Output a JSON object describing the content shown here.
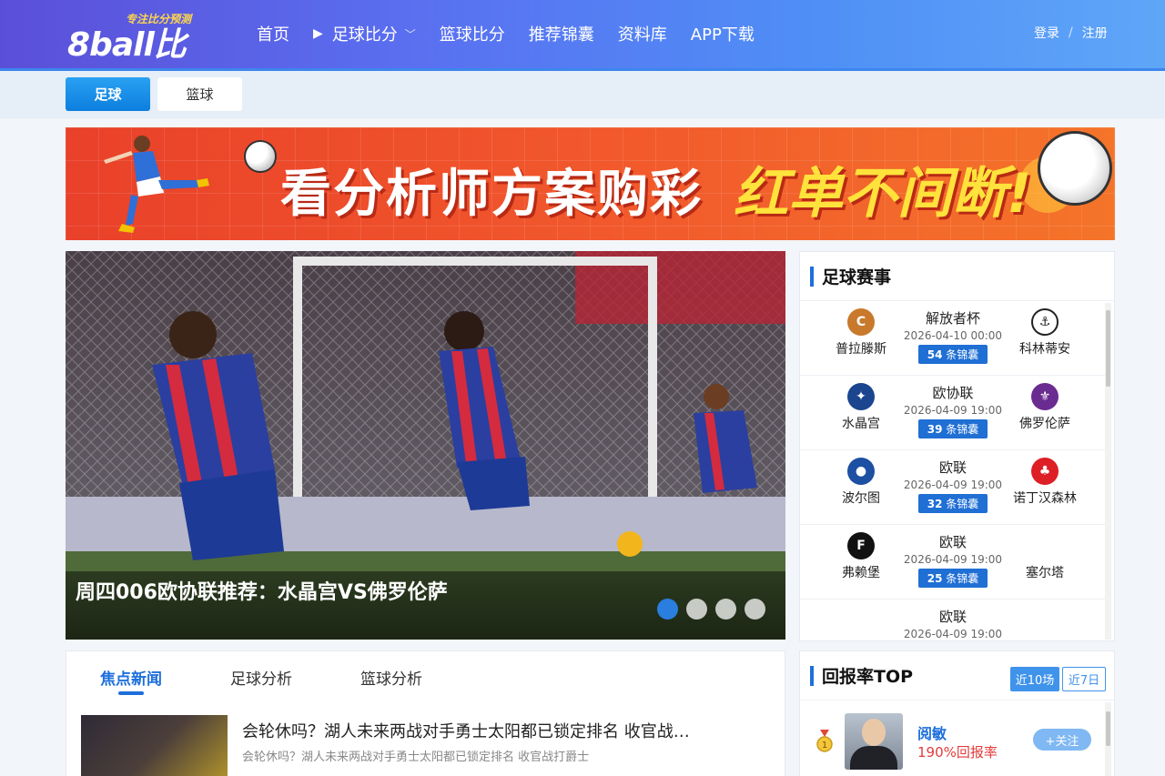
{
  "header": {
    "brand": "8ball比分",
    "slogan": "专注比分预测",
    "nav": [
      {
        "label": "首页"
      },
      {
        "label": "足球比分"
      },
      {
        "label": "篮球比分"
      },
      {
        "label": "推荐锦囊"
      },
      {
        "label": "资料库"
      },
      {
        "label": "APP下载"
      }
    ],
    "login": "登录",
    "separator": "/",
    "register": "注册"
  },
  "sport_tabs": [
    {
      "label": "足球",
      "active": true
    },
    {
      "label": "篮球",
      "active": false
    }
  ],
  "banner": {
    "text_main": "看分析师方案购彩",
    "text_highlight": "红单不间断!"
  },
  "hero": {
    "caption": "周四006欧协联推荐：水晶宫VS佛罗伦萨",
    "slides": 4,
    "active_slide": 1
  },
  "matches": {
    "title": "足球赛事",
    "tips_suffix": "条锦囊",
    "items": [
      {
        "league": "解放者杯",
        "time": "2026-04-10 00:00",
        "tips": "54",
        "home": "普拉滕斯",
        "away": "科林蒂安",
        "home_color": "#c9792b",
        "away_color": "#222222"
      },
      {
        "league": "欧协联",
        "time": "2026-04-09 19:00",
        "tips": "39",
        "home": "水晶宫",
        "away": "佛罗伦萨",
        "home_color": "#1b458f",
        "away_color": "#6a2c91"
      },
      {
        "league": "欧联",
        "time": "2026-04-09 19:00",
        "tips": "32",
        "home": "波尔图",
        "away": "诺丁汉森林",
        "home_color": "#1d4fa3",
        "away_color": "#dd1f26"
      },
      {
        "league": "欧联",
        "time": "2026-04-09 19:00",
        "tips": "25",
        "home": "弗赖堡",
        "away": "塞尔塔",
        "home_color": "#111111",
        "away_color": "#ffffff"
      },
      {
        "league": "欧联",
        "time": "2026-04-09 19:00",
        "tips": "",
        "home": "",
        "away": "",
        "home_color": "#ffffff",
        "away_color": "#ffffff"
      }
    ]
  },
  "news": {
    "tabs": [
      {
        "label": "焦点新闻",
        "active": true
      },
      {
        "label": "足球分析",
        "active": false
      },
      {
        "label": "篮球分析",
        "active": false
      }
    ],
    "items": [
      {
        "title": "会轮休吗？湖人未来两战对手勇士太阳都已锁定排名 收官战…",
        "summary": "会轮休吗？湖人未来两战对手勇士太阳都已锁定排名 收官战打爵士"
      }
    ]
  },
  "rank": {
    "title": "回报率TOP",
    "filters": [
      {
        "label": "近10场",
        "active": true
      },
      {
        "label": "近7日",
        "active": false
      }
    ],
    "experts": [
      {
        "rank": "1",
        "name": "阅敏",
        "rate": "190%回报率",
        "follow": "+关注"
      }
    ]
  }
}
